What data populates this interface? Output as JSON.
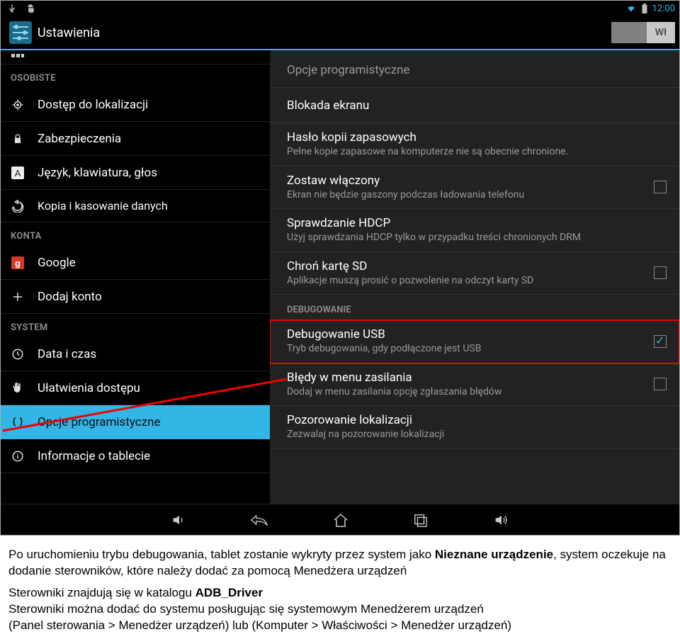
{
  "statusbar": {
    "time": "12:00"
  },
  "titlebar": {
    "title": "Ustawienia",
    "toggle_label": "Wł"
  },
  "sidebar": {
    "partial_top_label": "",
    "cats": [
      {
        "header": "OSOBISTE",
        "items": [
          {
            "icon": "target-icon",
            "label": "Dostęp do lokalizacji"
          },
          {
            "icon": "lock-icon",
            "label": "Zabezpieczenia"
          },
          {
            "icon": "a-icon",
            "label": "Język, klawiatura, głos"
          },
          {
            "icon": "restore-icon",
            "label": "Kopia i kasowanie danych"
          }
        ]
      },
      {
        "header": "KONTA",
        "items": [
          {
            "icon": "google-icon",
            "label": "Google"
          },
          {
            "icon": "plus-icon",
            "label": "Dodaj konto"
          }
        ]
      },
      {
        "header": "SYSTEM",
        "items": [
          {
            "icon": "clock-icon",
            "label": "Data i czas"
          },
          {
            "icon": "hand-icon",
            "label": "Ułatwienia dostępu"
          },
          {
            "icon": "braces-icon",
            "label": "Opcje programistyczne",
            "selected": true
          },
          {
            "icon": "info-icon",
            "label": "Informacje o tablecie"
          }
        ]
      }
    ]
  },
  "main": {
    "header": "Opcje programistyczne",
    "groups": [
      {
        "items": [
          {
            "title": "Blokada ekranu"
          },
          {
            "title": "Hasło kopii zapasowych",
            "sub": "Pełne kopie zapasowe na komputerze nie są obecnie chronione."
          },
          {
            "title": "Zostaw włączony",
            "sub": "Ekran nie będzie gaszony podczas ładowania telefonu",
            "checkbox": true,
            "checked": false
          },
          {
            "title": "Sprawdzanie HDCP",
            "sub": "Użyj sprawdzania HDCP tylko w przypadku treści chronionych DRM"
          },
          {
            "title": "Chroń kartę SD",
            "sub": "Aplikacje muszą prosić o pozwolenie na odczyt karty SD",
            "checkbox": true,
            "checked": false
          }
        ]
      },
      {
        "header": "DEBUGOWANIE",
        "items": [
          {
            "title": "Debugowanie USB",
            "sub": "Tryb debugowania, gdy podłączone jest USB",
            "checkbox": true,
            "checked": true,
            "highlight": true
          },
          {
            "title": "Błędy w menu zasilania",
            "sub": "Dodaj w menu zasilania opcję zgłaszania błędów",
            "checkbox": true,
            "checked": false
          },
          {
            "title": "Pozorowanie lokalizacji",
            "sub": "Zezwalaj na pozorowanie lokalizacji"
          }
        ]
      }
    ]
  },
  "doc": {
    "p1a": "Po uruchomieniu trybu debugowania, tablet zostanie wykryty przez system jako ",
    "p1b": "Nieznane urządzenie",
    "p1c": ", system oczekuje na dodanie sterowników, które należy dodać za pomocą Menedżera urządzeń",
    "p2a": "Sterowniki znajdują się w katalogu ",
    "p2b": "ADB_Driver",
    "p3": "Sterowniki można dodać do systemu posługując się systemowym Menedżerem urządzeń",
    "p4": "(Panel sterowania > Menedżer urządzeń) lub (Komputer > Właściwości > Menedżer urządzeń)"
  }
}
